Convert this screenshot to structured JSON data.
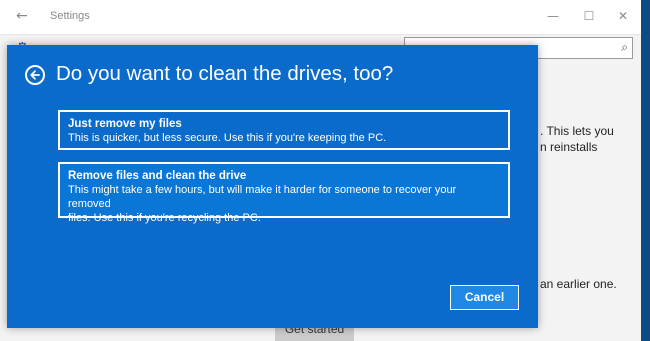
{
  "window": {
    "title": "Settings",
    "back_icon": "←",
    "minimize_icon": "—",
    "maximize_icon": "☐",
    "close_icon": "✕",
    "gear_icon": "⚙",
    "search_icon": "⌕"
  },
  "background": {
    "text_1": ". This lets you",
    "text_2": "n reinstalls",
    "text_3": "an earlier one.",
    "get_started_label": "Get started"
  },
  "dialog": {
    "title": "Do you want to clean the drives, too?",
    "options": [
      {
        "title": "Just remove my files",
        "description": "This is quicker, but less secure. Use this if you're keeping the PC."
      },
      {
        "title": "Remove files and clean the drive",
        "description_line1": "This might take a few hours, but will make it harder for someone to recover your removed",
        "description_line2": "files. Use this if you're recycling the PC."
      }
    ],
    "cancel_label": "Cancel"
  },
  "colors": {
    "dialog_bg": "#0b6bcb",
    "selected_option_bg": "#0a76d6",
    "desktop_edge": "#0a4c86"
  }
}
